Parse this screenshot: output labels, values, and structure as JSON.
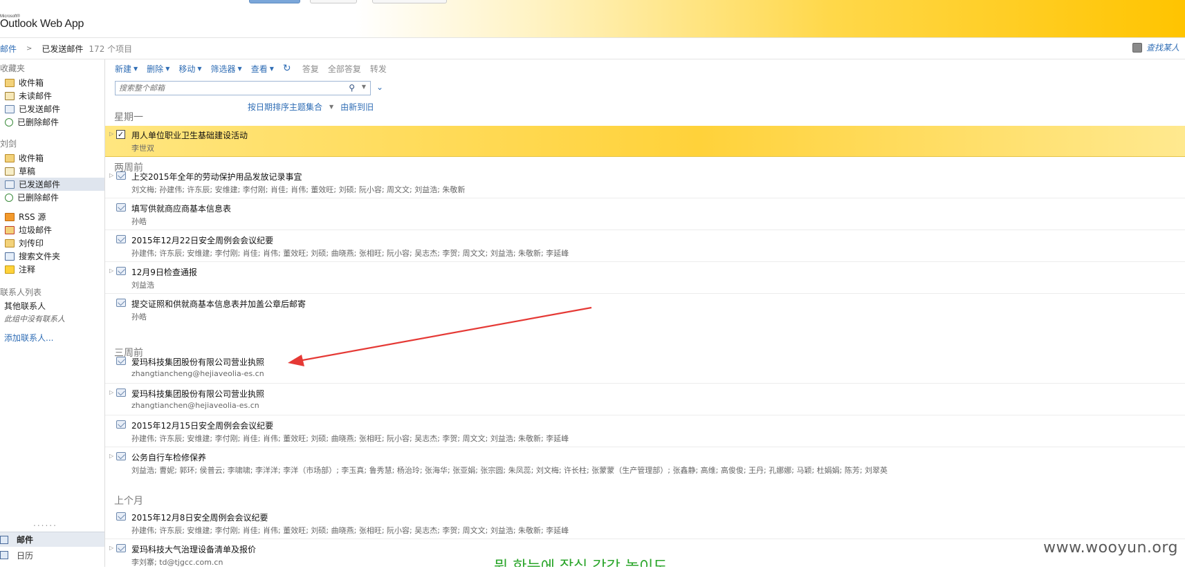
{
  "app": {
    "microsoft_label": "Microsoft®",
    "title": "Outlook Web App"
  },
  "breadcrumb": {
    "root": "邮件",
    "current": "已发送邮件",
    "count": "172 个项目"
  },
  "find_people": "查找某人",
  "leftnav": {
    "favorites_title": "收藏夹",
    "favorites": [
      {
        "label": "收件箱",
        "icon": "inbox-folder-icon"
      },
      {
        "label": "未读邮件",
        "icon": "unread-search-folder-icon"
      },
      {
        "label": "已发送邮件",
        "icon": "sent-folder-icon"
      },
      {
        "label": "已删除邮件",
        "icon": "deleted-folder-icon"
      }
    ],
    "mailbox_title": "刘剑",
    "mailbox": [
      {
        "label": "收件箱",
        "icon": "inbox-folder-icon"
      },
      {
        "label": "草稿",
        "icon": "drafts-folder-icon"
      },
      {
        "label": "已发送邮件",
        "icon": "sent-folder-icon",
        "selected": true
      },
      {
        "label": "已删除邮件",
        "icon": "deleted-folder-icon"
      }
    ],
    "other_folders": [
      {
        "label": "RSS 源",
        "icon": "rss-folder-icon"
      },
      {
        "label": "垃圾邮件",
        "icon": "junk-folder-icon"
      },
      {
        "label": "刘传印",
        "icon": "folder-icon"
      },
      {
        "label": "搜索文件夹",
        "icon": "search-folder-icon"
      },
      {
        "label": "注释",
        "icon": "notes-folder-icon"
      }
    ],
    "contacts_title": "联系人列表",
    "contacts_group": "其他联系人",
    "contacts_empty": "此组中没有联系人",
    "add_contact": "添加联系人...",
    "bottom_mail": "邮件",
    "bottom_calendar": "日历"
  },
  "toolbar": {
    "new": "新建",
    "delete": "删除",
    "move": "移动",
    "filter": "筛选器",
    "view": "查看",
    "reply": "答复",
    "reply_all": "全部答复",
    "forward": "转发"
  },
  "search": {
    "placeholder": "搜索整个邮箱"
  },
  "sort": {
    "arrange": "按日期排序主题集合",
    "order": "由新到旧"
  },
  "groups": [
    {
      "label": "星期一"
    },
    {
      "label": "两周前"
    },
    {
      "label": "三周前"
    },
    {
      "label": "上个月"
    }
  ],
  "messages": [
    {
      "subject": "用人单位职业卫生基础建设活动",
      "from": "李世双",
      "selected": true,
      "checked": true,
      "expandable": true
    },
    {
      "subject": "上交2015年全年的劳动保护用品发放记录事宜",
      "from": "刘文梅; 孙建伟; 许东辰; 安维建; 李付刚; 肖佳; 肖伟; 董效旺; 刘硕; 阮小容; 周文文; 刘益浩; 朱敬新",
      "expandable": true
    },
    {
      "subject": "填写供就商应商基本信息表",
      "from": "孙皓",
      "expandable": false
    },
    {
      "subject": "2015年12月22日安全周例会会议纪要",
      "from": "孙建伟; 许东辰; 安维建; 李付刚; 肖佳; 肖伟; 董效旺; 刘硕; 曲晓燕; 张相旺; 阮小容; 吴志杰; 李贺; 周文文; 刘益浩; 朱敬新; 李延峰",
      "expandable": false
    },
    {
      "subject": "12月9日检查通报",
      "from": "刘益浩",
      "expandable": true
    },
    {
      "subject": "提交证照和供就商基本信息表并加盖公章后邮寄",
      "from": "孙皓",
      "expandable": false
    },
    {
      "subject": "爱玛科技集团股份有限公司营业执照",
      "from": "zhangtiancheng@hejiaveolia-es.cn",
      "expandable": false
    },
    {
      "subject": "爱玛科技集团股份有限公司营业执照",
      "from": "zhangtianchen@hejiaveolia-es.cn",
      "expandable": true
    },
    {
      "subject": "2015年12月15日安全周例会会议纪要",
      "from": "孙建伟; 许东辰; 安维建; 李付刚; 肖佳; 肖伟; 董效旺; 刘硕; 曲晓燕; 张相旺; 阮小容; 吴志杰; 李贺; 周文文; 刘益浩; 朱敬新; 李延峰",
      "expandable": false
    },
    {
      "subject": "公务自行车检修保养",
      "from": "刘益浩; 曹妮; 郭环; 侯普云; 李啸啸; 李洋洋; 李洋（市场部）; 李玉真; 鲁秀慧; 杨治玲; 张海华; 张亚娟; 张宗圆; 朱凤蕊; 刘文梅; 许长柱; 张蒙蒙（生产管理部）; 张鑫静; 高维; 高俊俊; 王丹; 孔娜娜; 马颖; 杜娟娟; 陈芳; 刘翠英",
      "expandable": true
    },
    {
      "subject": "2015年12月8日安全周例会会议纪要",
      "from": "孙建伟; 许东辰; 安维建; 李付刚; 肖佳; 肖伟; 董效旺; 刘硕; 曲晓燕; 张相旺; 阮小容; 吴志杰; 李贺; 周文文; 刘益浩; 朱敬新; 李延峰",
      "expandable": false
    },
    {
      "subject": "爱玛科技大气治理设备清单及报价",
      "from": "李刘寨; td@tjgcc.com.cn",
      "expandable": true
    }
  ],
  "watermark": "www.wooyun.org",
  "overlay_text": "뭔 한눈에 잘실 각각 놀이도",
  "colors": {
    "link": "#2f6db5",
    "selected_row": "#ffd23a",
    "annotation_arrow": "#e53935"
  }
}
